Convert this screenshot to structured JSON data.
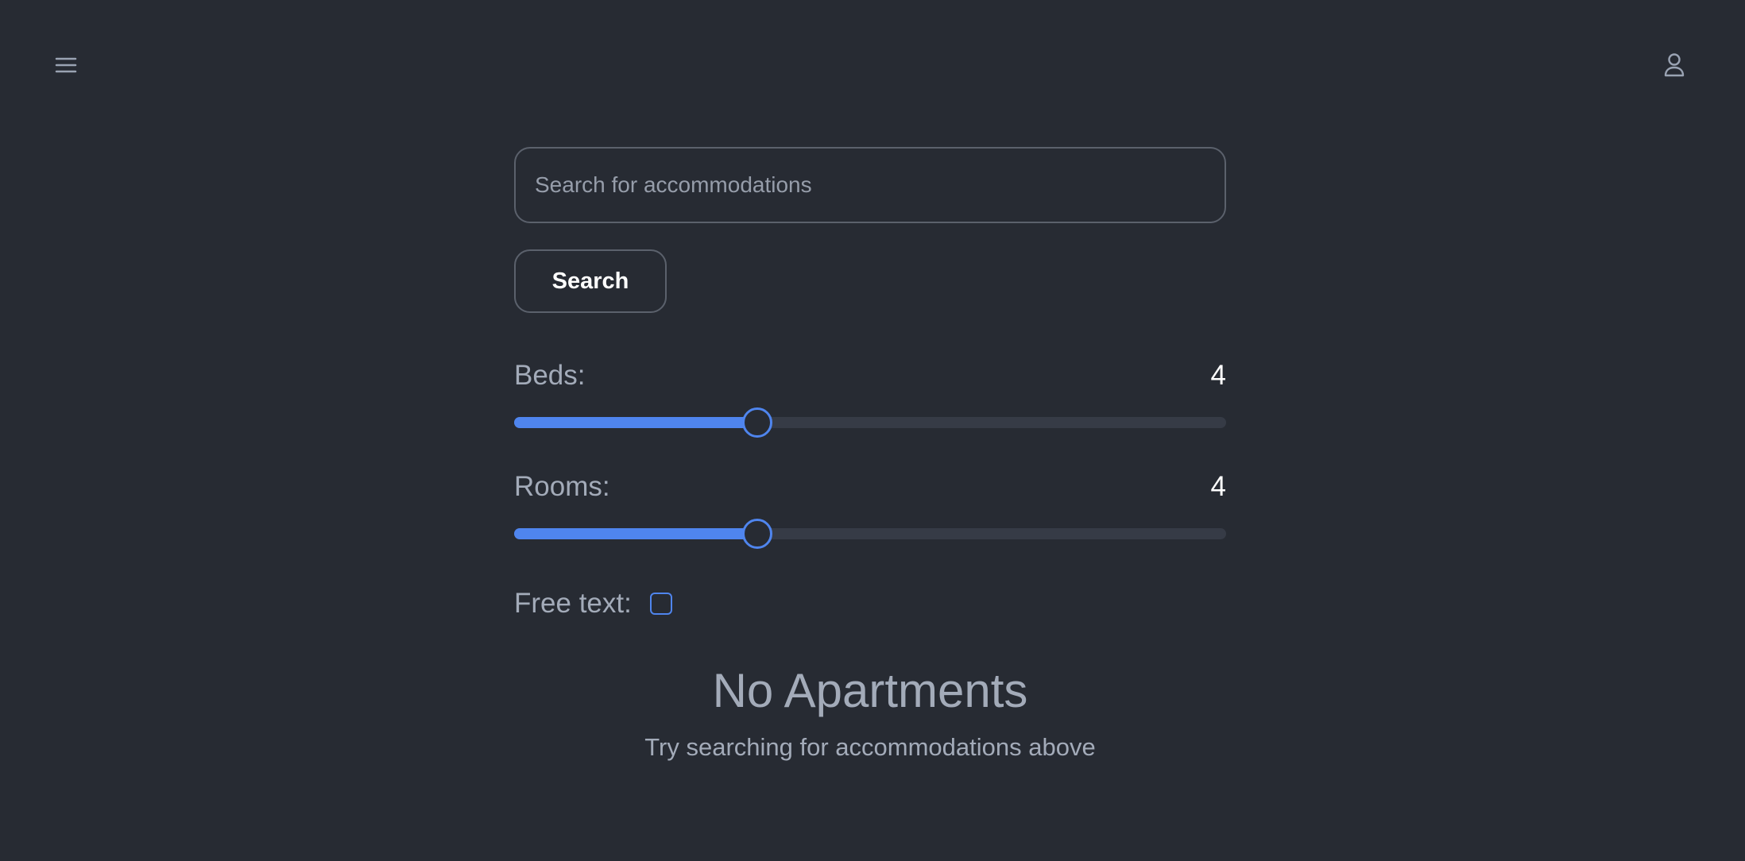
{
  "header": {
    "menu_icon": "hamburger-menu-icon",
    "profile_icon": "user-icon"
  },
  "search": {
    "placeholder": "Search for accommodations",
    "value": "",
    "button_label": "Search"
  },
  "filters": {
    "beds": {
      "label": "Beds:",
      "value": "4",
      "fraction": 0.34
    },
    "rooms": {
      "label": "Rooms:",
      "value": "4",
      "fraction": 0.34
    },
    "free_text": {
      "label": "Free text:",
      "checked": false
    }
  },
  "empty_state": {
    "title": "No Apartments",
    "subtitle": "Try searching for accommodations above"
  },
  "colors": {
    "background": "#272b33",
    "accent": "#4f85ee",
    "text_muted": "#a3abb9"
  }
}
